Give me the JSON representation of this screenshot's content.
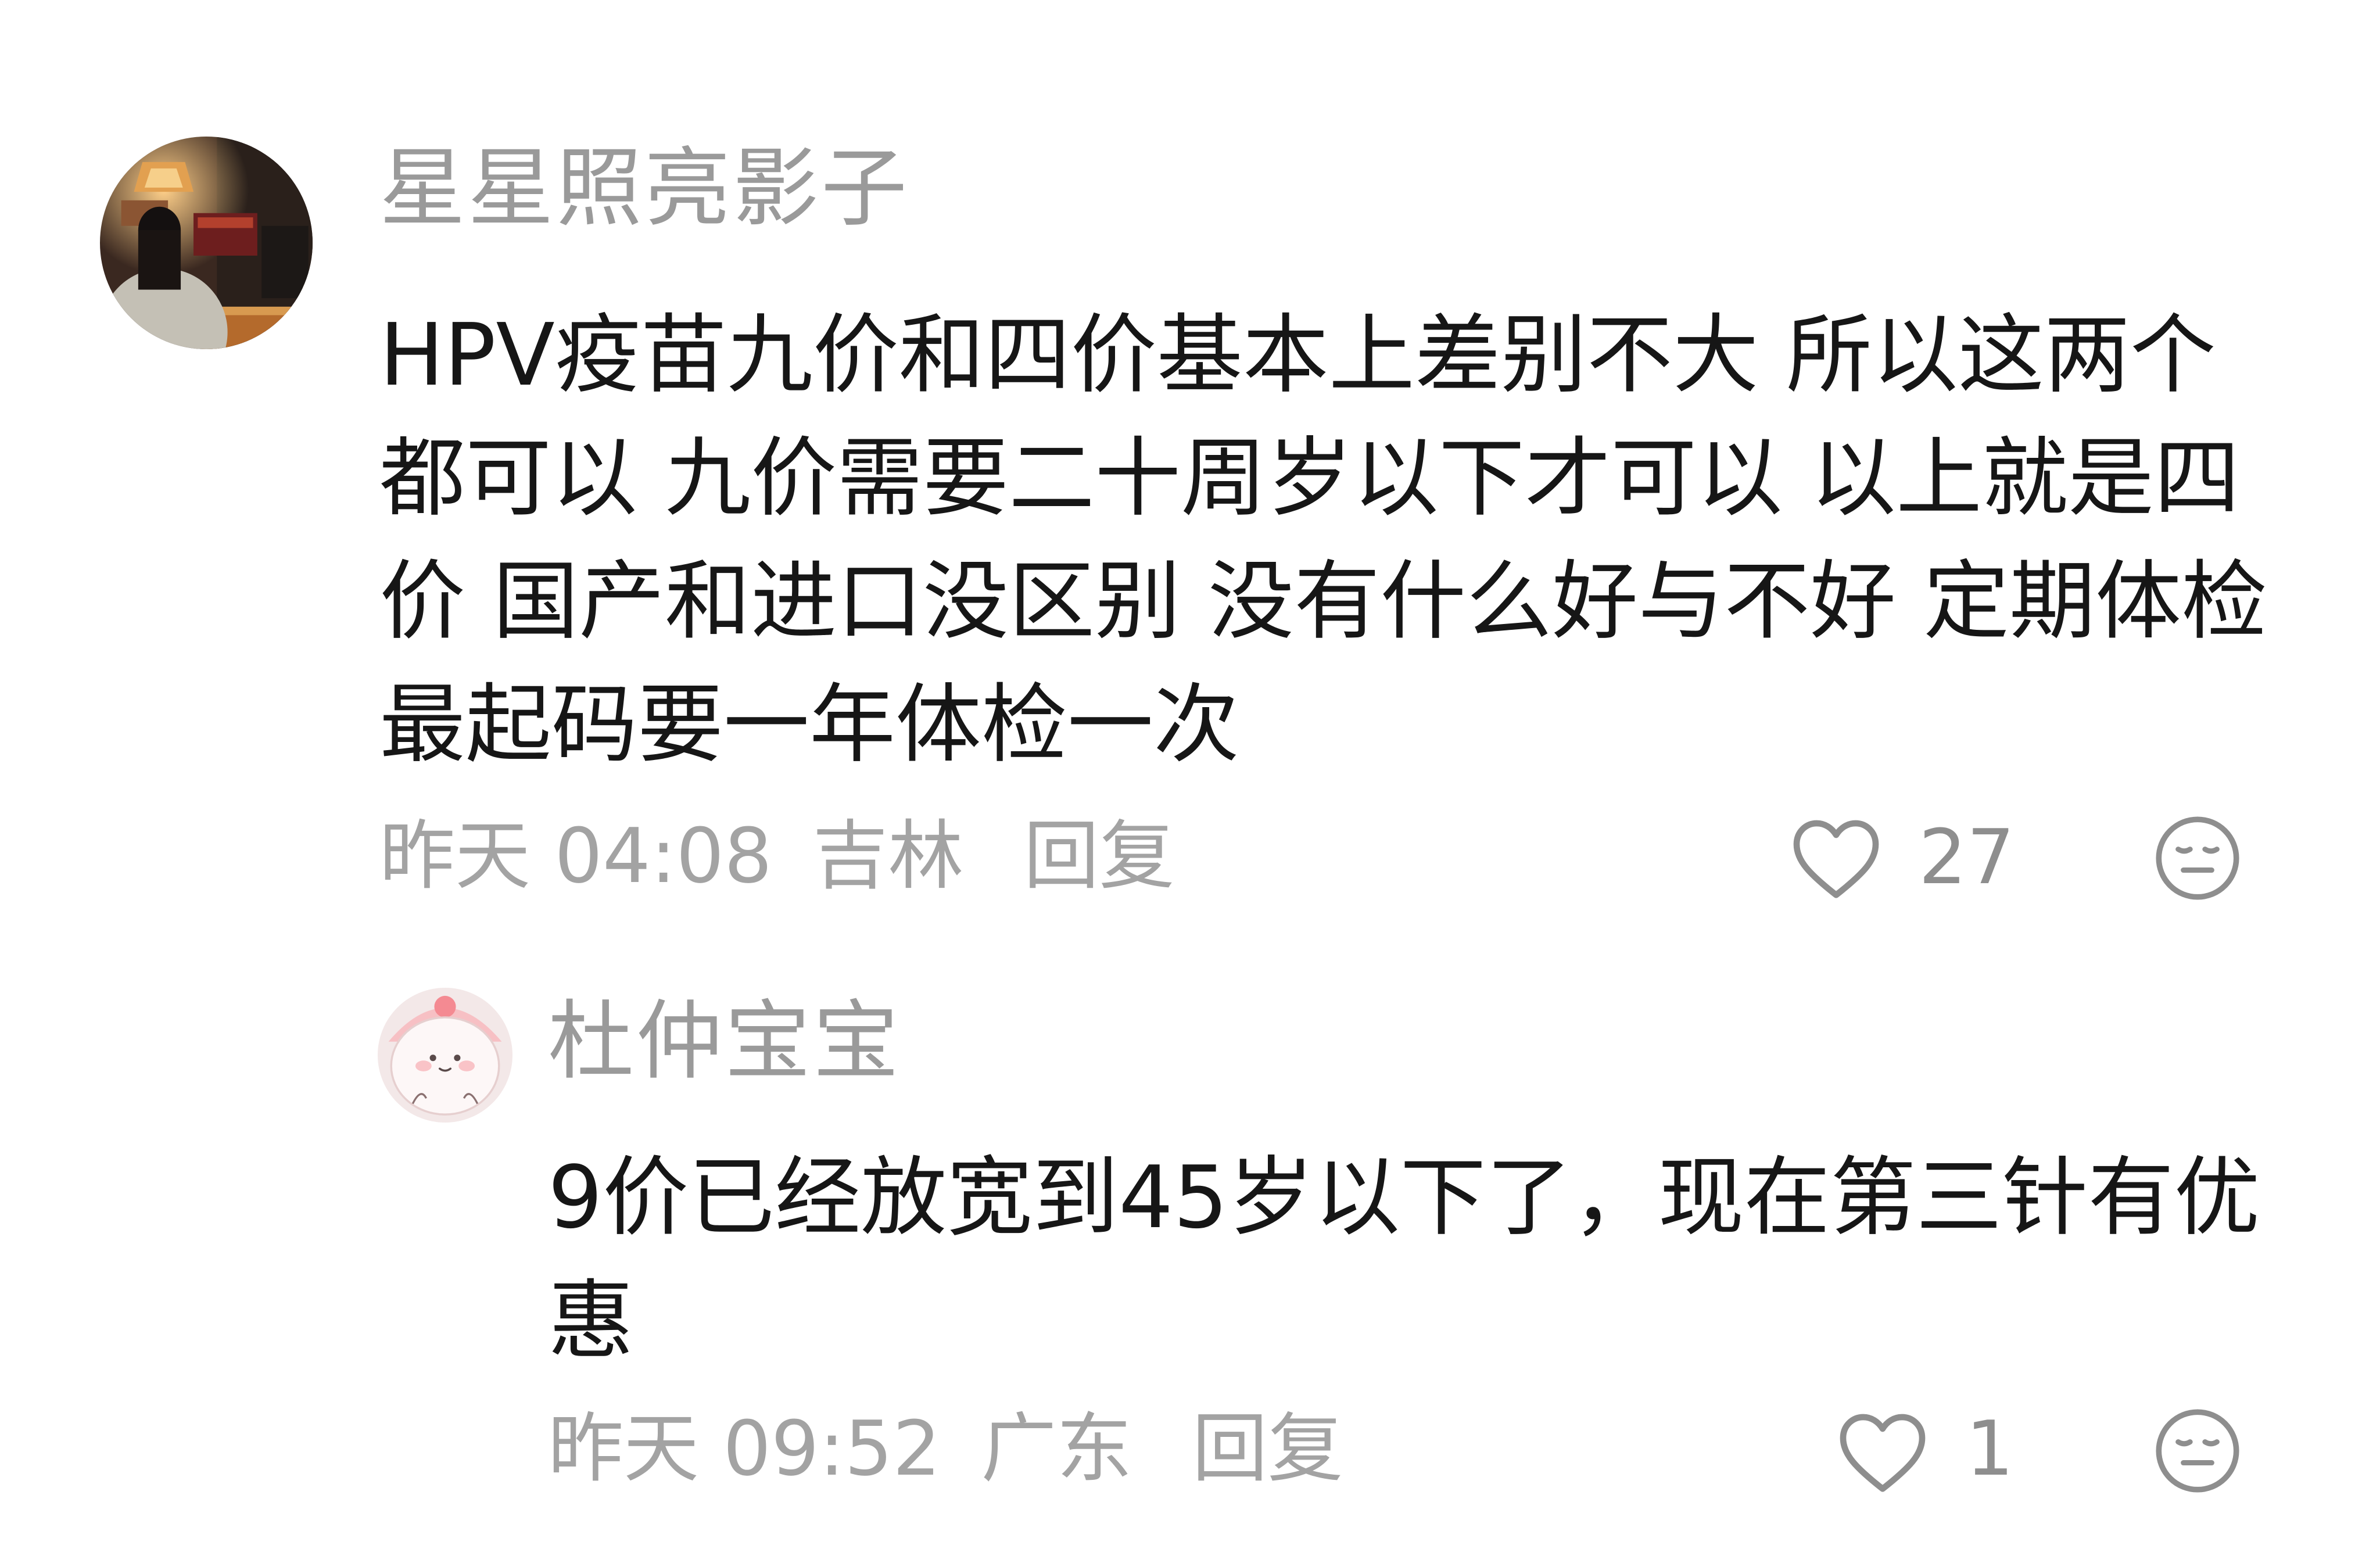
{
  "comments": [
    {
      "username": "星星照亮影子",
      "text": "HPV疫苗九价和四价基本上差别不大 所以这两个都可以 九价需要二十周岁以下才可以 以上就是四价 国产和进口没区别 没有什么好与不好 定期体检 最起码要一年体检一次",
      "time": "昨天 04:08",
      "location": "吉林",
      "reply_label": "回复",
      "like_count": "27",
      "avatar_icon": "user-photo-avatar",
      "like_icon": "heart-outline-icon",
      "reaction_icon": "meh-face-icon",
      "reply": {
        "username": "杜仲宝宝",
        "text": "9价已经放宽到45岁以下了，现在第三针有优惠",
        "time": "昨天 09:52",
        "location": "广东",
        "reply_label": "回复",
        "like_count": "1",
        "avatar_icon": "cartoon-avatar",
        "like_icon": "heart-outline-icon",
        "reaction_icon": "meh-face-icon"
      }
    }
  ],
  "colors": {
    "username": "#9a9a9a",
    "text": "#161616",
    "meta": "#a3a3a3",
    "icon": "#8e8e8e",
    "background": "#ffffff"
  }
}
